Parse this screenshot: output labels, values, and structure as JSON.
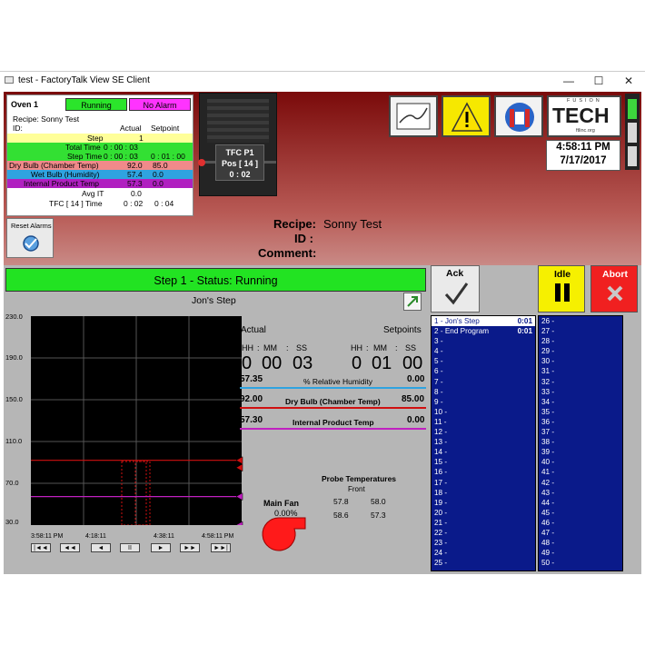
{
  "window": {
    "title": "test - FactoryTalk View SE Client",
    "min": "—",
    "max": "☐",
    "close": "✕"
  },
  "oven": {
    "name": "Oven 1",
    "run_state": "Running",
    "alarm_state": "No Alarm",
    "recipe_line": "Recipe: Sonny Test",
    "id_line": "ID:",
    "col_actual": "Actual",
    "col_setpoint": "Setpoint",
    "step_label": "Step",
    "step_value": "1",
    "total_time_label": "Total Time",
    "total_time_value": "0 : 00 : 03",
    "step_time_label": "Step Time",
    "step_time_value": "0 : 00 : 03",
    "step_time_set": "0 : 01 : 00",
    "dry_label": "Dry Bulb (Chamber Temp)",
    "dry_actual": "92.0",
    "dry_set": "85.0",
    "wet_label": "Wet Bulb (Humidity)",
    "wet_actual": "57.4",
    "wet_set": "0.0",
    "ipt_label": "Internal Product Temp",
    "ipt_actual": "57.3",
    "ipt_set": "0.0",
    "avgit_label": "Avg IT",
    "avgit_value": "0.0",
    "tfc_label": "TFC [ 14 ] Time",
    "tfc_actual": "0 : 02",
    "tfc_set": "0 : 04"
  },
  "reset_alarms": "Reset Alarms",
  "tfc_box": {
    "title": "TFC P1",
    "pos": "Pos [ 14 ]",
    "time": "0 : 02"
  },
  "logo": {
    "line1": "FUSION",
    "line2": "TECH",
    "url": "ftlinc.org"
  },
  "clock": {
    "time": "4:58:11 PM",
    "date": "7/17/2017"
  },
  "recipe_center": {
    "recipe_label": "Recipe:",
    "recipe_value": "Sonny Test",
    "id_label": "ID :",
    "comment_label": "Comment:"
  },
  "step_status": "Step 1  - Status: Running",
  "step_name": "Jon's Step",
  "chart_data": {
    "type": "line",
    "y_ticks": [
      "230.0",
      "190.0",
      "150.0",
      "110.0",
      "70.0",
      "30.0"
    ],
    "ylim": [
      30,
      230
    ],
    "x_ticks": [
      "3:58:11 PM",
      "4:18:11",
      "4:38:11",
      "4:58:11 PM"
    ],
    "series": [
      {
        "color": "#d01010",
        "y": 92.0
      },
      {
        "color": "#c020c0",
        "y": 57.3
      }
    ]
  },
  "transport": [
    "|◄◄",
    "◄◄",
    "◄",
    "II",
    "►",
    "►►",
    "►►|"
  ],
  "readouts": {
    "actual_label": "Actual",
    "setpoints_label": "Setpoints",
    "hh": "HH",
    "mm": "MM",
    "ss": "SS",
    "sep": ":",
    "a_hh": "0",
    "a_mm": "00",
    "a_ss": "03",
    "s_hh": "0",
    "s_mm": "01",
    "s_ss": "00",
    "rh_actual": "57.35",
    "rh_label": "% Relative Humidity",
    "rh_set": "0.00",
    "db_actual": "92.00",
    "db_label": "Dry Bulb (Chamber Temp)",
    "db_set": "85.00",
    "ipt_actual": "57.30",
    "ipt_label": "Internal Product Temp",
    "ipt_set": "0.00"
  },
  "main_fan": {
    "label": "Main Fan",
    "value": "0.00%"
  },
  "probe": {
    "title": "Probe Temperatures",
    "front": "Front",
    "v1": "57.8",
    "v2": "58.0",
    "v3": "58.6",
    "v4": "57.3"
  },
  "buttons": {
    "ack": "Ack",
    "idle": "Idle",
    "abort": "Abort"
  },
  "steps_left": [
    {
      "label": "1 - Jon's Step",
      "time": "0:01"
    },
    {
      "label": "2 - End Program",
      "time": "0:01"
    },
    {
      "label": "3 -"
    },
    {
      "label": "4 -"
    },
    {
      "label": "5 -"
    },
    {
      "label": "6 -"
    },
    {
      "label": "7 -"
    },
    {
      "label": "8 -"
    },
    {
      "label": "9 -"
    },
    {
      "label": "10 -"
    },
    {
      "label": "11 -"
    },
    {
      "label": "12 -"
    },
    {
      "label": "13 -"
    },
    {
      "label": "14 -"
    },
    {
      "label": "15 -"
    },
    {
      "label": "16 -"
    },
    {
      "label": "17 -"
    },
    {
      "label": "18 -"
    },
    {
      "label": "19 -"
    },
    {
      "label": "20 -"
    },
    {
      "label": "21 -"
    },
    {
      "label": "22 -"
    },
    {
      "label": "23 -"
    },
    {
      "label": "24 -"
    },
    {
      "label": "25 -"
    }
  ],
  "steps_right": [
    "26 -",
    "27 -",
    "28 -",
    "29 -",
    "30 -",
    "31 -",
    "32 -",
    "33 -",
    "34 -",
    "35 -",
    "36 -",
    "37 -",
    "38 -",
    "39 -",
    "40 -",
    "41 -",
    "42 -",
    "43 -",
    "44 -",
    "45 -",
    "46 -",
    "47 -",
    "48 -",
    "49 -",
    "50 -"
  ]
}
